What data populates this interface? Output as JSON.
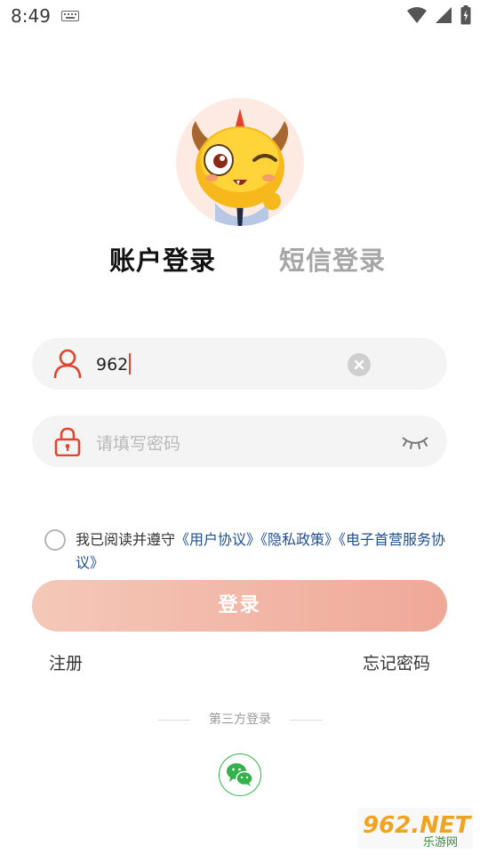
{
  "status_bar": {
    "time": "8:49"
  },
  "tabs": {
    "account": "账户登录",
    "sms": "短信登录"
  },
  "form": {
    "username_value": "962",
    "password_placeholder": "请填写密码"
  },
  "agreement": {
    "prefix": "我已阅读并遵守",
    "link_user": "《用户协议》",
    "link_privacy": "《隐私政策》",
    "link_service": "《电子首营服务协议》"
  },
  "buttons": {
    "login": "登录",
    "register": "注册",
    "forgot": "忘记密码"
  },
  "third_party": {
    "label": "第三方登录"
  },
  "watermark": {
    "brand": "962.NET",
    "subtitle": "乐游网"
  },
  "colors": {
    "accent_red": "#e0452e",
    "login_gradient_start": "#f4c8b8",
    "login_gradient_end": "#f0a898",
    "wechat_green": "#33b24a",
    "link_blue": "#1f4f8f"
  }
}
